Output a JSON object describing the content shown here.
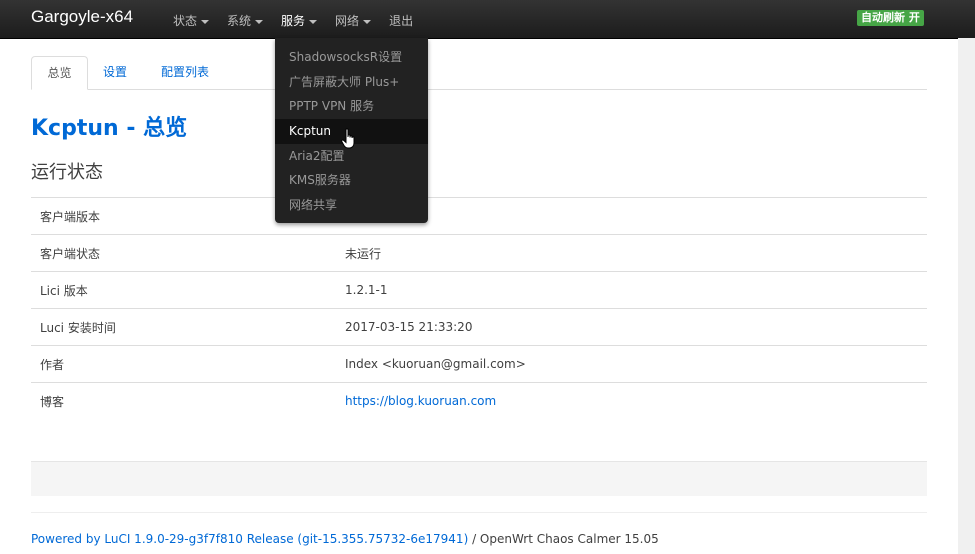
{
  "navbar": {
    "brand": "Gargoyle-x64",
    "menu": [
      {
        "label": "状态",
        "has_caret": true
      },
      {
        "label": "系统",
        "has_caret": true
      },
      {
        "label": "服务",
        "has_caret": true
      },
      {
        "label": "网络",
        "has_caret": true
      },
      {
        "label": "退出",
        "has_caret": false
      }
    ],
    "auto_refresh": "自动刷新 开"
  },
  "dropdown": {
    "items": [
      "ShadowsocksR设置",
      "广告屏蔽大师 Plus+",
      "PPTP VPN 服务",
      "Kcptun",
      "Aria2配置",
      "KMS服务器",
      "网络共享"
    ],
    "hovered": "Kcptun"
  },
  "tabs": [
    {
      "label": "总览",
      "active": true
    },
    {
      "label": "设置",
      "active": false
    },
    {
      "label": "配置列表",
      "active": false
    }
  ],
  "page_title": "Kcptun - 总览",
  "section_title": "运行状态",
  "status_table": [
    {
      "key": "客户端版本",
      "value": ""
    },
    {
      "key": "客户端状态",
      "value": "未运行"
    },
    {
      "key": "Lici 版本",
      "value": "1.2.1-1"
    },
    {
      "key": "Luci 安装时间",
      "value": "2017-03-15 21:33:20"
    },
    {
      "key": "作者",
      "value": "Index <kuoruan@gmail.com>"
    },
    {
      "key": "博客",
      "value": "https://blog.kuoruan.com",
      "is_link": true
    }
  ],
  "footer": {
    "link": "Powered by LuCI 1.9.0-29-g3f7f810 Release (git-15.355.75732-6e17941)",
    "suffix": " / OpenWrt Chaos Calmer 15.05"
  },
  "colors": {
    "link": "#0069d6",
    "navbar": "#222222",
    "badge": "#46a546"
  }
}
